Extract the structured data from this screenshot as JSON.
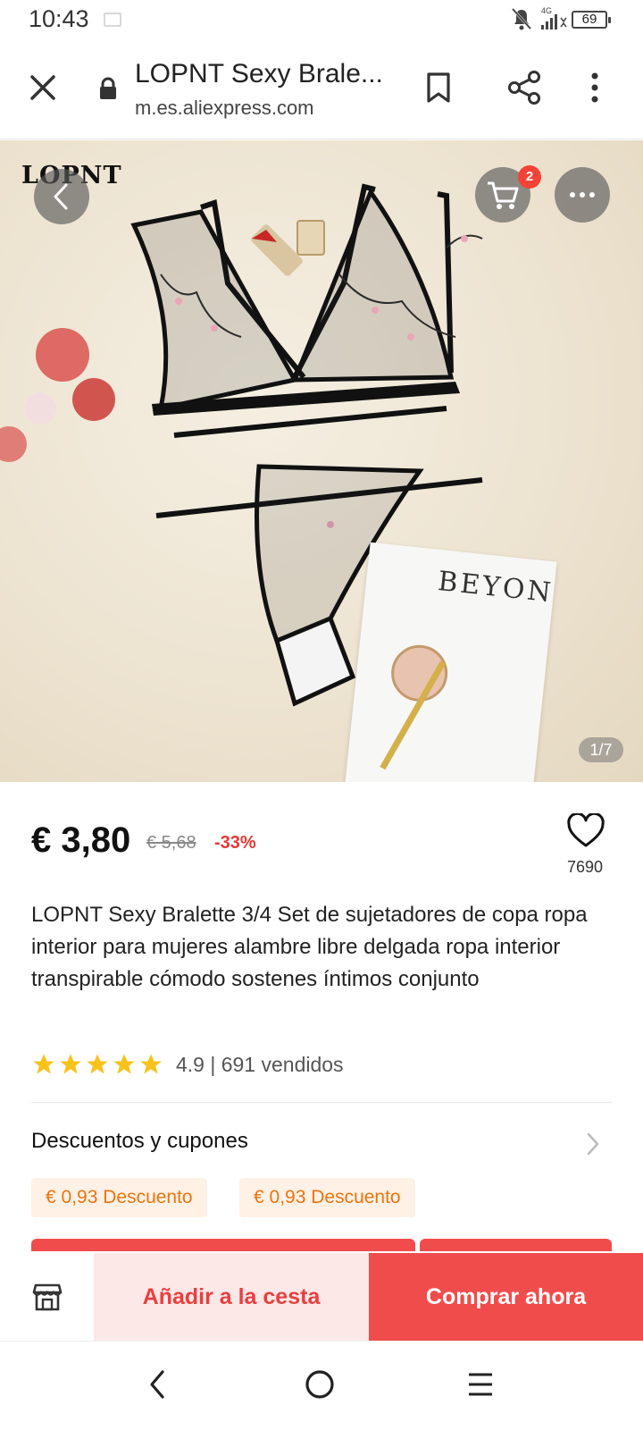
{
  "status_bar": {
    "time": "10:43",
    "network": "4G",
    "battery": "69"
  },
  "browser": {
    "page_title": "LOPNT Sexy Brale...",
    "url": "m.es.aliexpress.com"
  },
  "gallery": {
    "brand_logo": "LOPNT",
    "cart_count": "2",
    "image_counter": "1/7",
    "magazine_text": "BEYON"
  },
  "product": {
    "price": "€ 3,80",
    "old_price": "€ 5,68",
    "discount": "-33%",
    "wishlist_count": "7690",
    "title": "LOPNT Sexy Bralette 3/4 Set de sujetadores de copa ropa interior para mujeres alambre libre delgada ropa interior transpirable cómodo sostenes íntimos conjunto",
    "rating_stars": 5,
    "rating_summary": "4.9 | 691 vendidos"
  },
  "coupons": {
    "header": "Descuentos y cupones",
    "chips": [
      "€ 0,93 Descuento",
      "€ 0,93 Descuento"
    ]
  },
  "actions": {
    "add_to_cart": "Añadir a la cesta",
    "buy_now": "Comprar ahora"
  },
  "colors": {
    "accent_red": "#f14c4c",
    "discount_red": "#e53935",
    "coupon_orange": "#e8750f",
    "star_yellow": "#f7c21b"
  }
}
